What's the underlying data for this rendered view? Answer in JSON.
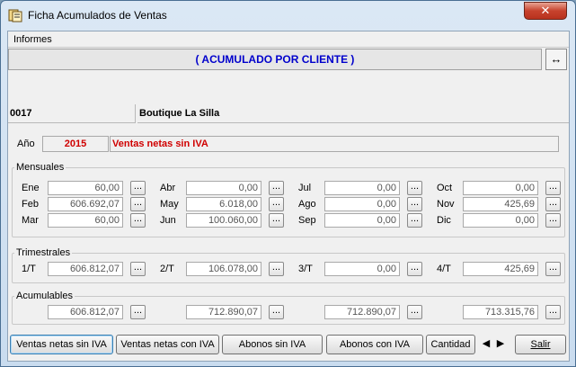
{
  "window": {
    "title": "Ficha Acumulados de Ventas",
    "close_label": "✕"
  },
  "menu": {
    "informes": "Informes"
  },
  "banner": {
    "text": "( ACUMULADO POR CLIENTE )",
    "resize_label": "↔"
  },
  "client": {
    "code": "0017",
    "name": "Boutique La Silla"
  },
  "year": {
    "label": "Año",
    "value": "2015",
    "description": "Ventas netas sin IVA"
  },
  "mensuales": {
    "label": "Mensuales",
    "months": [
      {
        "label": "Ene",
        "value": "60,00"
      },
      {
        "label": "Feb",
        "value": "606.692,07"
      },
      {
        "label": "Mar",
        "value": "60,00"
      },
      {
        "label": "Abr",
        "value": "0,00"
      },
      {
        "label": "May",
        "value": "6.018,00"
      },
      {
        "label": "Jun",
        "value": "100.060,00"
      },
      {
        "label": "Jul",
        "value": "0,00"
      },
      {
        "label": "Ago",
        "value": "0,00"
      },
      {
        "label": "Sep",
        "value": "0,00"
      },
      {
        "label": "Oct",
        "value": "0,00"
      },
      {
        "label": "Nov",
        "value": "425,69"
      },
      {
        "label": "Dic",
        "value": "0,00"
      }
    ]
  },
  "trimestrales": {
    "label": "Trimestrales",
    "quarters": [
      {
        "label": "1/T",
        "value": "606.812,07"
      },
      {
        "label": "2/T",
        "value": "106.078,00"
      },
      {
        "label": "3/T",
        "value": "0,00"
      },
      {
        "label": "4/T",
        "value": "425,69"
      }
    ]
  },
  "acumulables": {
    "label": "Acumulables",
    "values": [
      "606.812,07",
      "712.890,07",
      "712.890,07",
      "713.315,76"
    ]
  },
  "dots_label": "...",
  "buttons": {
    "ventas_sin_iva": "Ventas netas sin IVA",
    "ventas_con_iva": "Ventas netas con IVA",
    "abonos_sin_iva": "Abonos sin IVA",
    "abonos_con_iva": "Abonos con IVA",
    "cantidad": "Cantidad",
    "prev": "◀",
    "next": "▶",
    "salir": "Salir"
  }
}
